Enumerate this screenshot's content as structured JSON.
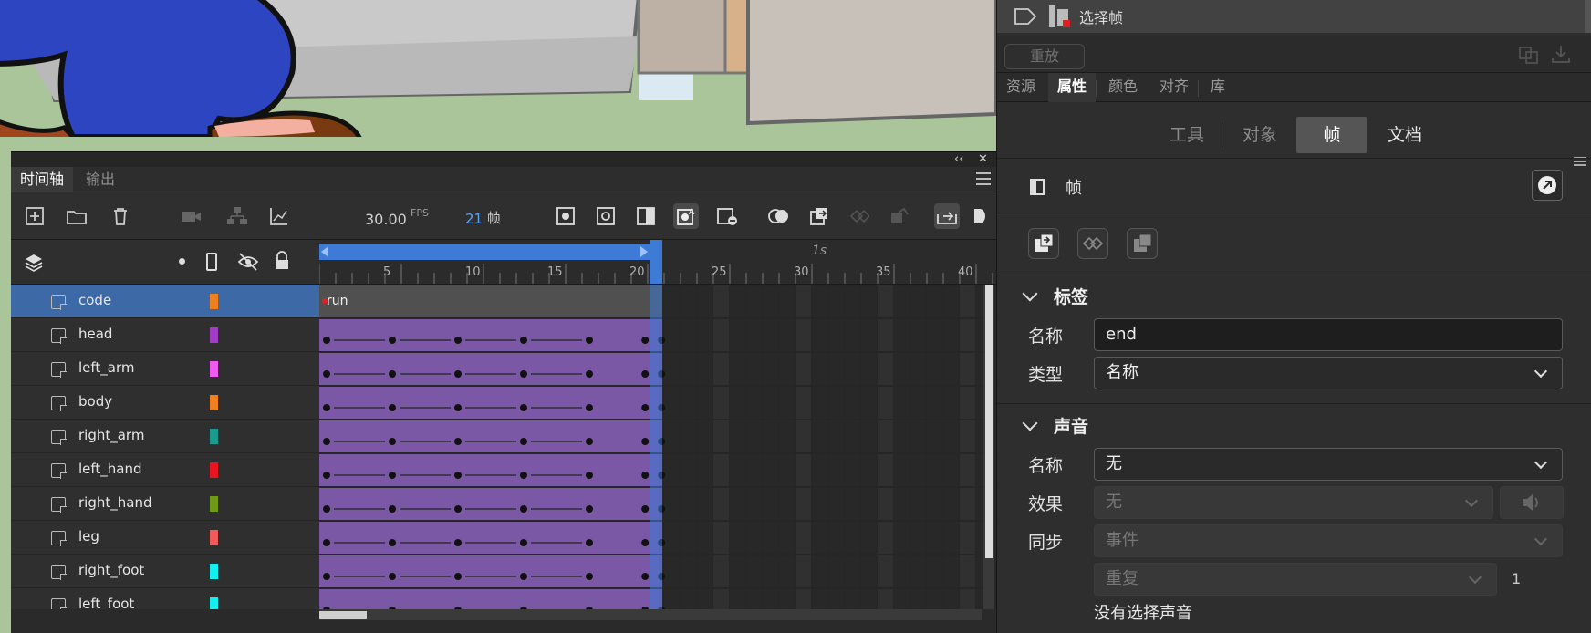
{
  "history": {
    "item_label": "选择帧",
    "replay_label": "重放"
  },
  "panel_tabs": [
    {
      "label": "资源",
      "active": false
    },
    {
      "label": "属性",
      "active": true
    },
    {
      "label": "颜色",
      "active": false
    },
    {
      "label": "对齐",
      "active": false
    },
    {
      "label": "库",
      "active": false
    }
  ],
  "sub_tabs": [
    {
      "label": "工具",
      "active": false
    },
    {
      "label": "对象",
      "active": false
    },
    {
      "label": "帧",
      "active": true
    },
    {
      "label": "文档",
      "active": false
    }
  ],
  "frame_section": {
    "title": "帧"
  },
  "label_section": {
    "title": "标签",
    "name_label": "名称",
    "name_value": "end",
    "type_label": "类型",
    "type_value": "名称"
  },
  "sound_section": {
    "title": "声音",
    "name_label": "名称",
    "name_value": "无",
    "effect_label": "效果",
    "effect_value": "无",
    "sync_label": "同步",
    "sync_value": "事件",
    "repeat_value": "重复",
    "repeat_count": "1",
    "no_sound_text": "没有选择声音"
  },
  "timeline": {
    "tabs": [
      {
        "label": "时间轴",
        "active": true
      },
      {
        "label": "输出",
        "active": false
      }
    ],
    "fps_value": "30.00",
    "fps_unit": "FPS",
    "current_frame": "21",
    "frame_unit": "帧",
    "ruler_labels": [
      "5",
      "10",
      "15",
      "20",
      "25",
      "30",
      "35",
      "40"
    ],
    "second_marker": "1s",
    "code_label": "run",
    "layers": [
      {
        "name": "code",
        "color": "#f07f1e",
        "selected": true
      },
      {
        "name": "head",
        "color": "#a33cc8"
      },
      {
        "name": "left_arm",
        "color": "#f05af0"
      },
      {
        "name": "body",
        "color": "#f07f1e"
      },
      {
        "name": "right_arm",
        "color": "#1a9a8e"
      },
      {
        "name": "left_hand",
        "color": "#e8141e"
      },
      {
        "name": "right_hand",
        "color": "#6e9a14"
      },
      {
        "name": "leg",
        "color": "#f05a5a"
      },
      {
        "name": "right_foot",
        "color": "#14f0f0"
      },
      {
        "name": "left_foot",
        "color": "#14f0f0"
      }
    ]
  },
  "colors": {
    "tween_purple": "#7a58a6",
    "selection_blue": "#3d6aa6",
    "playhead_blue": "#3e7bd6"
  }
}
